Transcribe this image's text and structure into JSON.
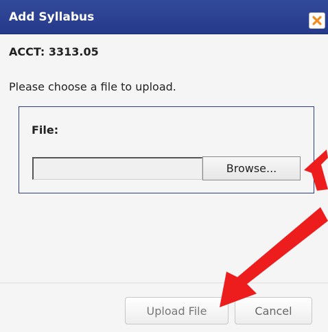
{
  "dialog": {
    "title": "Add Syllabus",
    "course_code": "ACCT: 3313.05",
    "instructions": "Please choose a file to upload."
  },
  "file_panel": {
    "label": "File:",
    "file_value": "",
    "browse_label": "Browse..."
  },
  "footer": {
    "upload_label": "Upload File",
    "cancel_label": "Cancel"
  },
  "icons": {
    "close": "close-x-icon",
    "annotation": "red-arrow-icon"
  },
  "colors": {
    "titlebar": "#26398a",
    "close_x": "#f28b1d",
    "panel_border": "#2d3b8f",
    "annotation_arrow": "#ee1d1d"
  }
}
